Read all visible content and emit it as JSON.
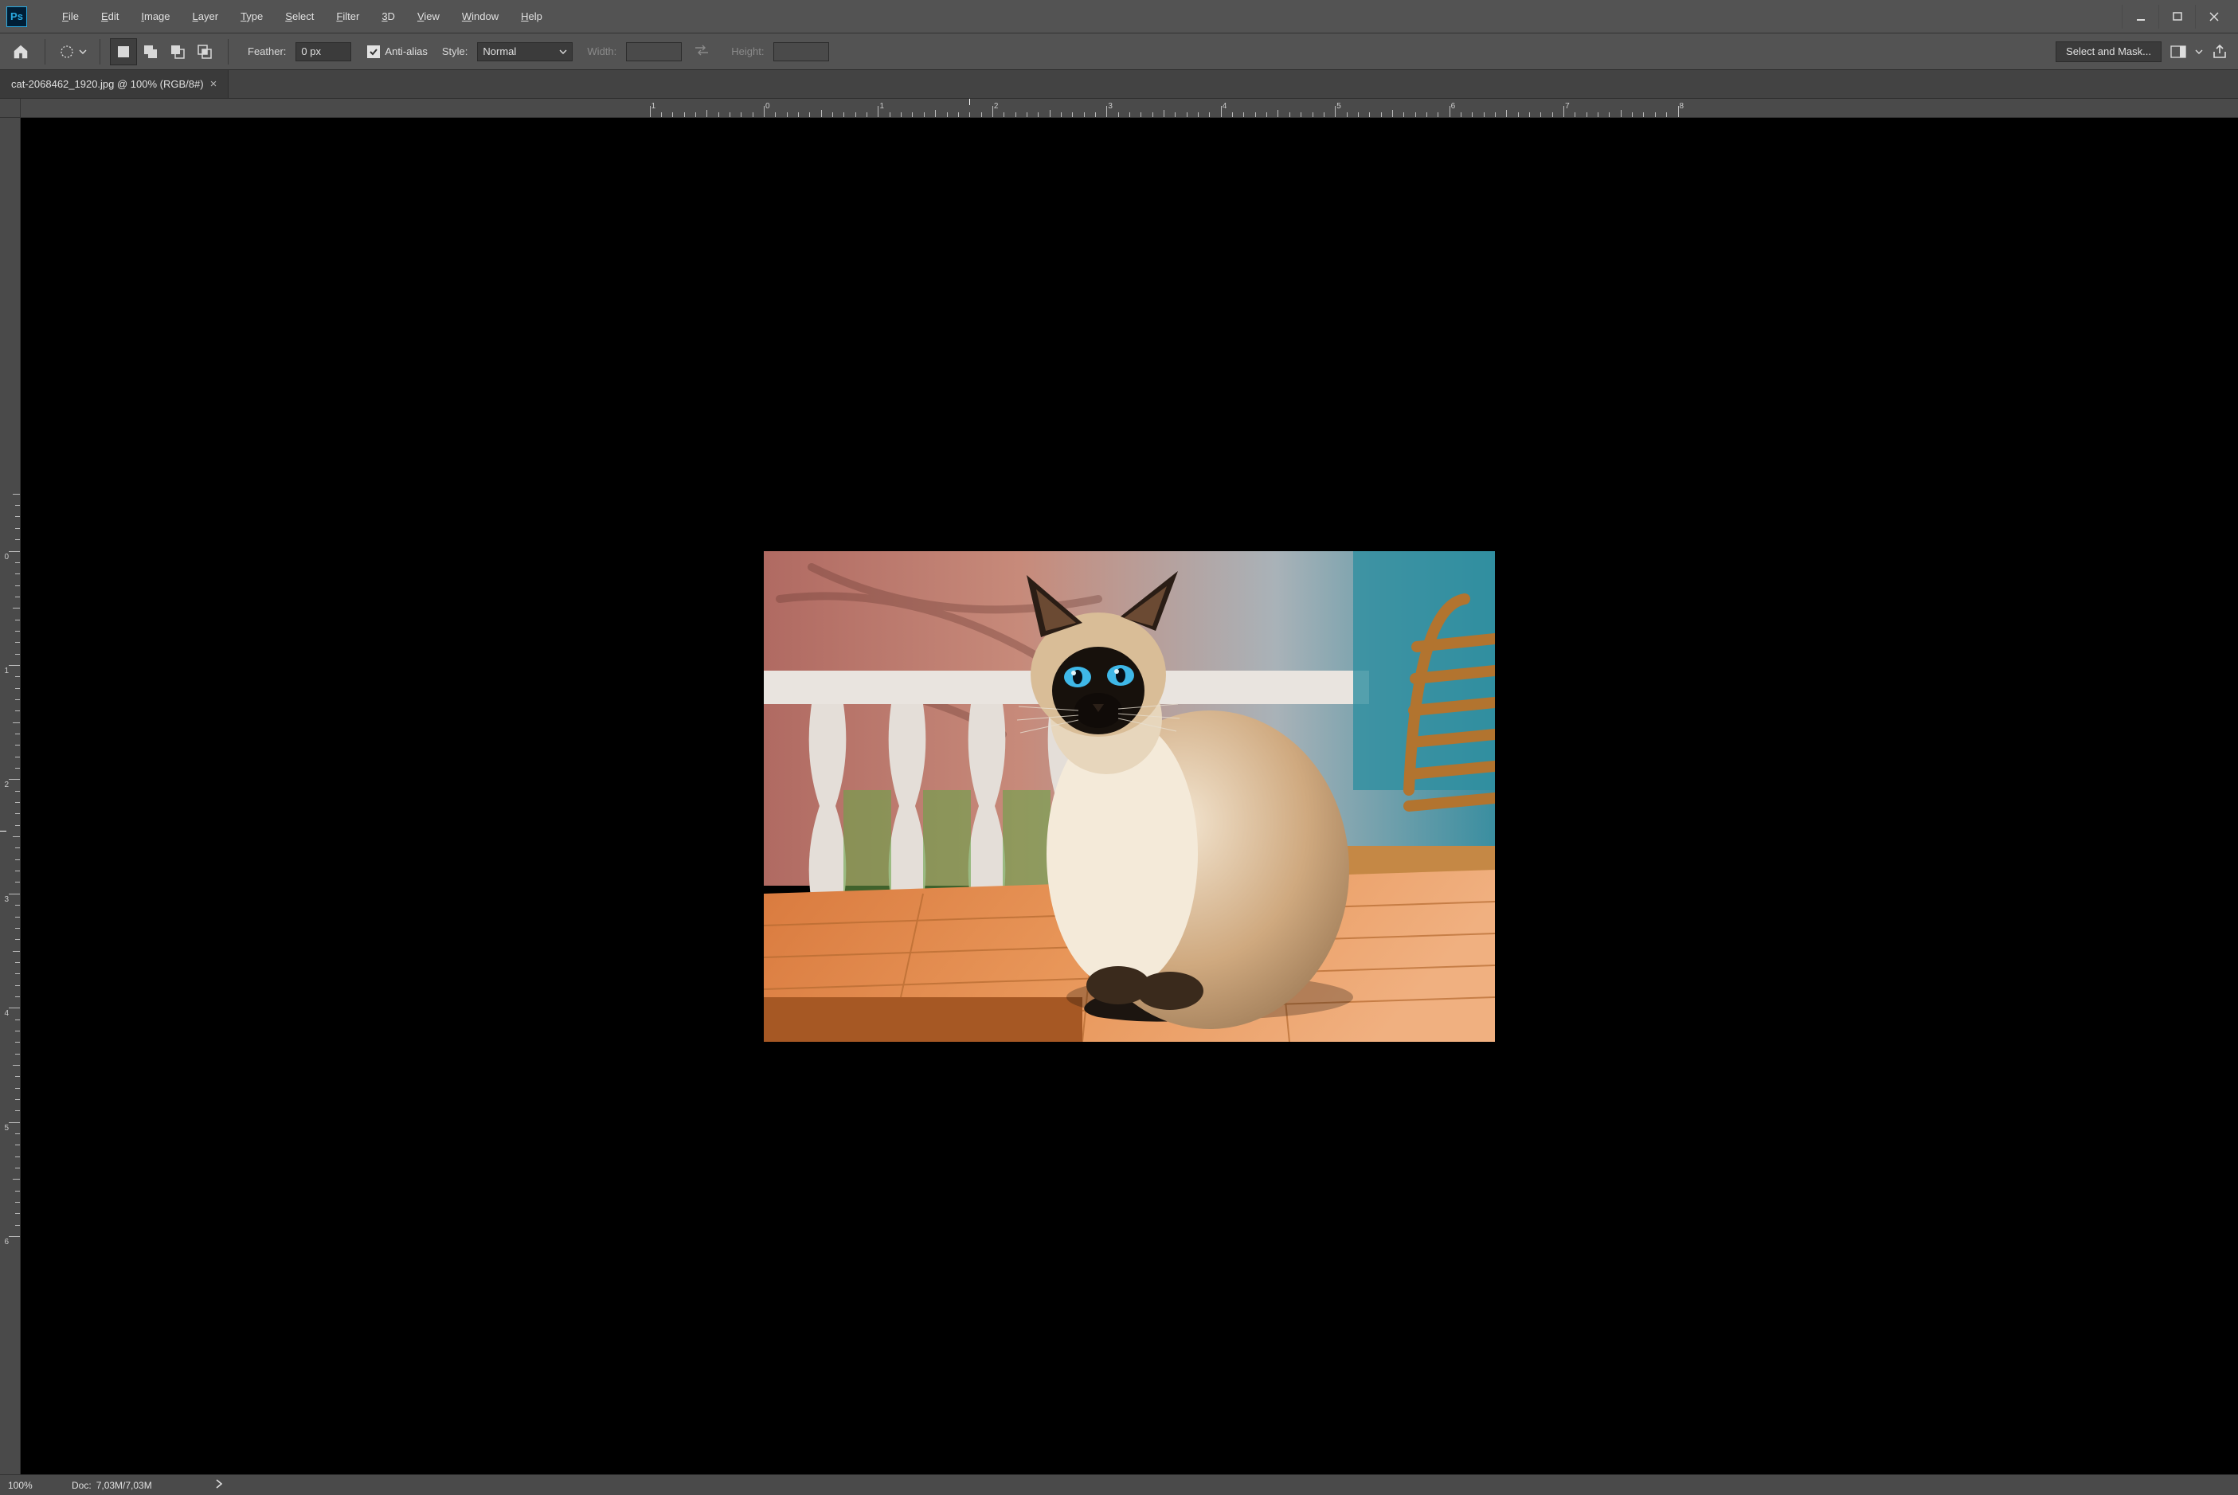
{
  "app": {
    "logo_text": "Ps"
  },
  "menu": {
    "file": {
      "label": "File",
      "ukey": "F"
    },
    "edit": {
      "label": "Edit",
      "ukey": "E"
    },
    "image": {
      "label": "Image",
      "ukey": "I"
    },
    "layer": {
      "label": "Layer",
      "ukey": "L"
    },
    "type": {
      "label": "Type",
      "ukey": "T"
    },
    "select": {
      "label": "Select",
      "ukey": "S"
    },
    "filter": {
      "label": "Filter",
      "ukey": "F"
    },
    "threeD": {
      "label": "3D",
      "ukey": "3"
    },
    "view": {
      "label": "View",
      "ukey": "V"
    },
    "window": {
      "label": "Window",
      "ukey": "W"
    },
    "help": {
      "label": "Help",
      "ukey": "H"
    }
  },
  "options": {
    "feather_label": "Feather:",
    "feather_value": "0 px",
    "antialias_label": "Anti-alias",
    "antialias_checked": true,
    "style_label": "Style:",
    "style_value": "Normal",
    "width_label": "Width:",
    "width_value": "",
    "height_label": "Height:",
    "height_value": "",
    "select_mask_label": "Select and Mask..."
  },
  "document": {
    "tab_title": "cat-2068462_1920.jpg @ 100% (RGB/8#)",
    "image_description": "Siamese cat with blue eyes sitting on a wooden table, white balustrade and wooden chair behind"
  },
  "rulers": {
    "h_majors": [
      "1",
      "0",
      "1",
      "2",
      "3",
      "4",
      "5",
      "6",
      "7"
    ],
    "h_cursor_between": "1-2",
    "v_majors": [
      "0",
      "1",
      "2",
      "3",
      "4"
    ]
  },
  "status": {
    "zoom": "100%",
    "doc_label": "Doc:",
    "doc_size": "7,03M/7,03M"
  }
}
